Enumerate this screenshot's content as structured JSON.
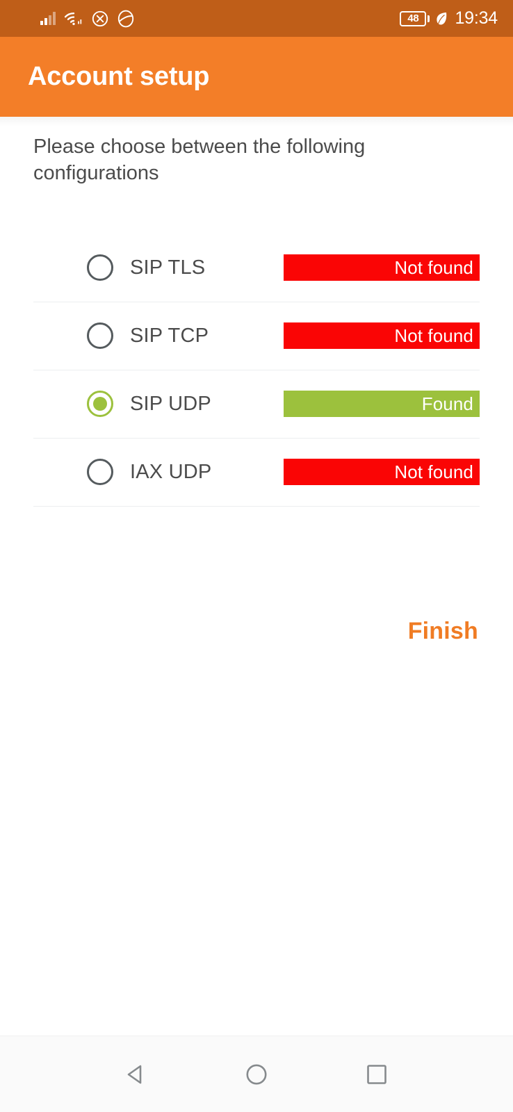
{
  "status_bar": {
    "signal_icon": "signal-bars-icon",
    "wifi_icon": "wifi-icon",
    "mute_icon": "cancel-circle-icon",
    "face_icon": "face-circle-icon",
    "battery_level": "48",
    "power_saving_icon": "leaf-icon",
    "time": "19:34",
    "background_color": "#BF5E18"
  },
  "app_bar": {
    "title": "Account setup",
    "background_color": "#F37E28"
  },
  "content": {
    "instructions": "Please choose between the following configurations",
    "options": [
      {
        "label": "SIP TLS",
        "selected": false,
        "status": "Not found",
        "status_type": "bad",
        "status_color": "#FA0505"
      },
      {
        "label": "SIP TCP",
        "selected": false,
        "status": "Not found",
        "status_type": "bad",
        "status_color": "#FA0505"
      },
      {
        "label": "SIP UDP",
        "selected": true,
        "status": "Found",
        "status_type": "good",
        "status_color": "#9CC13D"
      },
      {
        "label": "IAX UDP",
        "selected": false,
        "status": "Not found",
        "status_type": "bad",
        "status_color": "#FA0505"
      }
    ],
    "finish_label": "Finish",
    "finish_color": "#F07C24"
  },
  "nav_bar": {
    "back_icon": "back-triangle-icon",
    "home_icon": "home-circle-icon",
    "recents_icon": "recents-square-icon"
  }
}
